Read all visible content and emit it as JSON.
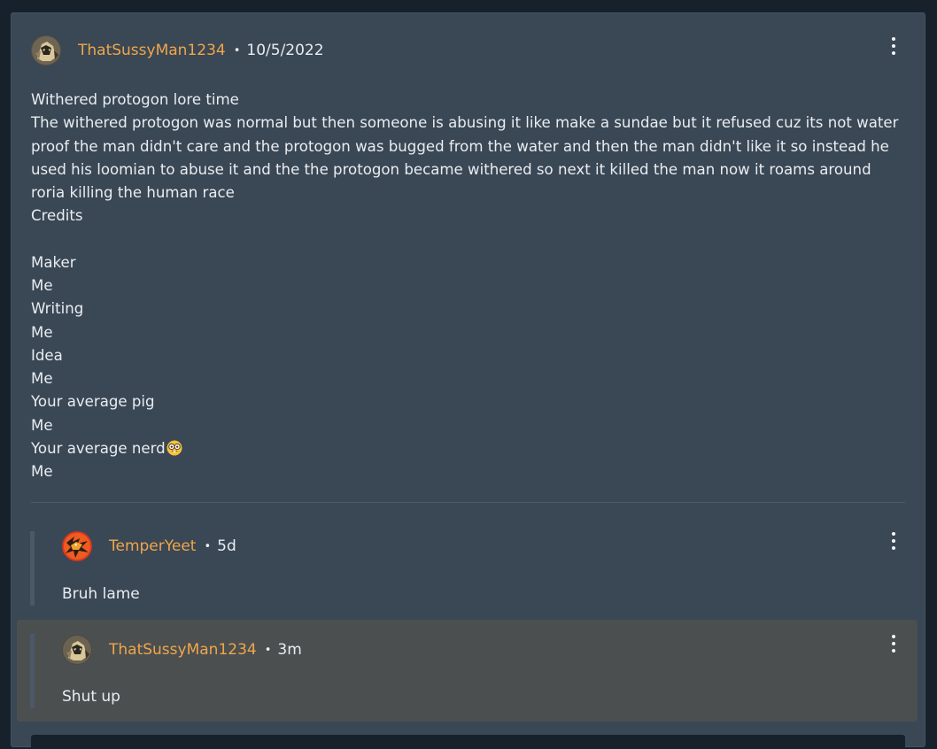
{
  "post": {
    "author": "ThatSussyMan1234",
    "separator": "•",
    "date": "10/5/2022",
    "menu_icon": "more-vertical-icon",
    "body_lines": [
      "Withered protogon lore time",
      "The withered protogon was normal but then someone is abusing it like make a sundae but it refused cuz its not water proof the man didn't care and the protogon was bugged from the water and then the man didn't like it so instead he used his loomian to abuse it and the the protogon became withered so next it killed the man now it roams around roria killing the human race",
      "Credits",
      "",
      "Maker",
      "Me",
      "Writing",
      "Me",
      "Idea",
      "Me",
      "Your average pig",
      "Me",
      "Your average nerd",
      "Me"
    ],
    "nerd_emoji": "nerd-face-emoji"
  },
  "replies": [
    {
      "author": "TemperYeet",
      "separator": "•",
      "time": "5d",
      "text": "Bruh lame",
      "menu_icon": "more-vertical-icon"
    },
    {
      "author": "ThatSussyMan1234",
      "separator": "•",
      "time": "3m",
      "text": "Shut up",
      "menu_icon": "more-vertical-icon",
      "highlighted": true
    }
  ],
  "colors": {
    "page_background": "#17212b",
    "card_background": "#3a4754",
    "username": "#f0a64b",
    "text": "#e8edf2",
    "highlight_background": "#4b4f50"
  }
}
